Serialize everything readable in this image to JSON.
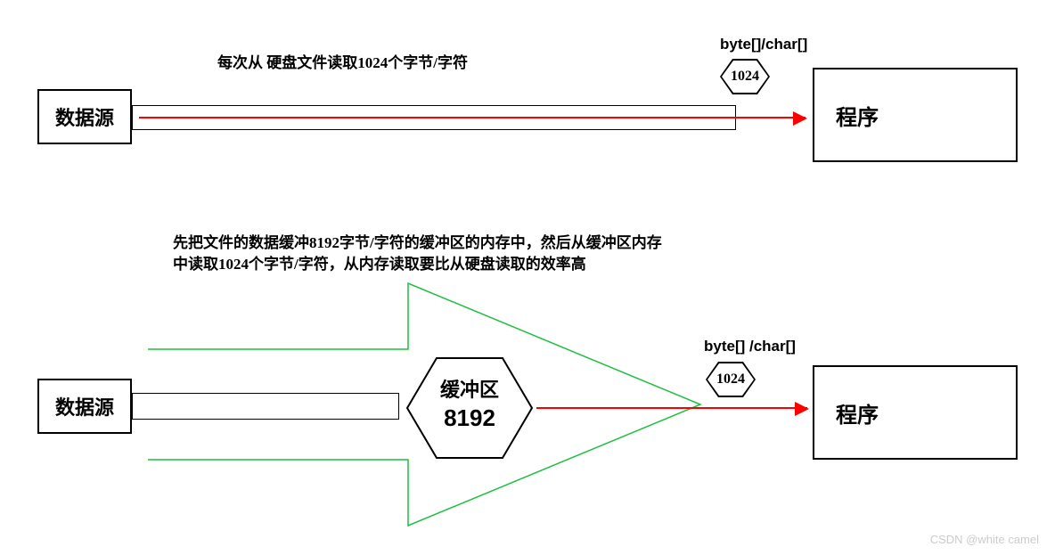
{
  "top": {
    "caption": "每次从 硬盘文件读取1024个字节/字符",
    "byte_label": "byte[]/char[]",
    "hex_value": "1024",
    "source": "数据源",
    "target": "程序"
  },
  "bottom": {
    "caption_line1": "先把文件的数据缓冲8192字节/字符的缓冲区的内存中，然后从缓冲区内存",
    "caption_line2": "中读取1024个字节/字符，从内存读取要比从硬盘读取的效率高",
    "byte_label": "byte[] /char[]",
    "hex_value": "1024",
    "buffer_label": "缓冲区",
    "buffer_size": "8192",
    "source": "数据源",
    "target": "程序"
  },
  "watermark_text": "CSDN @white camel"
}
